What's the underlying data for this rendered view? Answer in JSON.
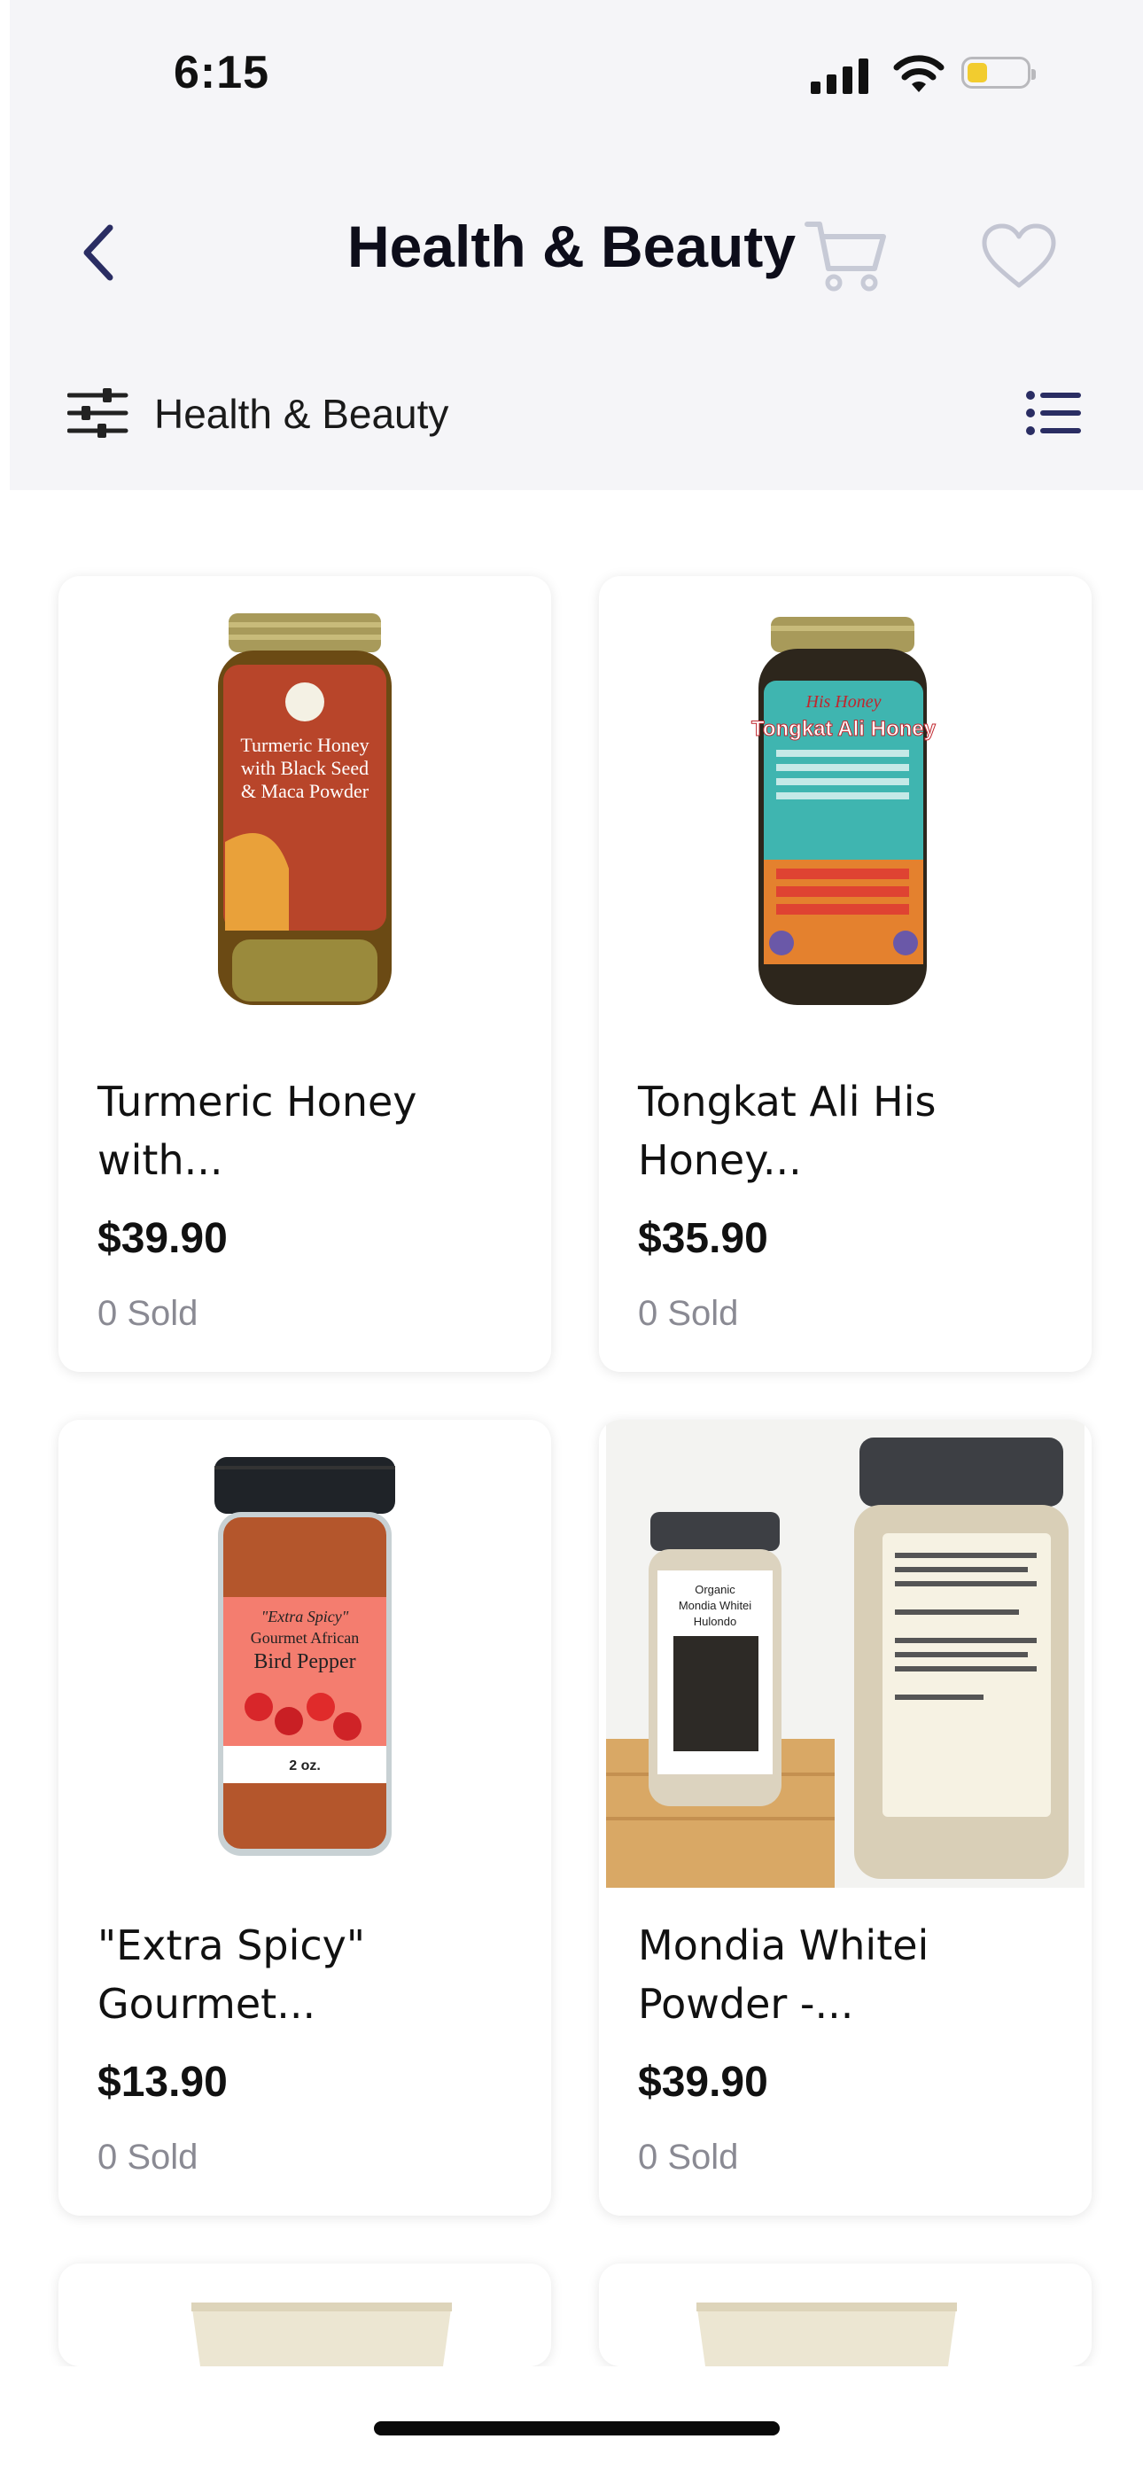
{
  "status_bar": {
    "time": "6:15"
  },
  "header": {
    "title": "Health & Beauty"
  },
  "filter": {
    "label": "Health & Beauty"
  },
  "products": [
    {
      "name": "Turmeric Honey with...",
      "price": "$39.90",
      "sold": "0 Sold",
      "jar_label_lines": [
        "Turmeric Honey",
        "with Black Seed",
        "& Maca Powder"
      ]
    },
    {
      "name": "Tongkat Ali His Honey...",
      "price": "$35.90",
      "sold": "0 Sold",
      "jar_label_lines": [
        "His Honey",
        "Tongkat Ali Honey"
      ]
    },
    {
      "name": "\"Extra Spicy\" Gourmet...",
      "price": "$13.90",
      "sold": "0 Sold",
      "jar_label_lines": [
        "\"Extra Spicy\"",
        "Gourmet African",
        "Bird Pepper",
        "2 oz."
      ]
    },
    {
      "name": "Mondia Whitei Powder -...",
      "price": "$39.90",
      "sold": "0 Sold",
      "jar_label_lines": [
        "Organic",
        "Mondia Whitei",
        "Hulondo"
      ]
    }
  ],
  "colors": {
    "accent": "#2a2d63",
    "header_bg": "#f5f5f8",
    "muted_text": "#8a8a93"
  },
  "icons": {
    "back": "chevron-left-icon",
    "cart": "cart-icon",
    "favorite": "heart-icon",
    "filter": "sliders-icon",
    "view_toggle": "list-view-icon"
  }
}
